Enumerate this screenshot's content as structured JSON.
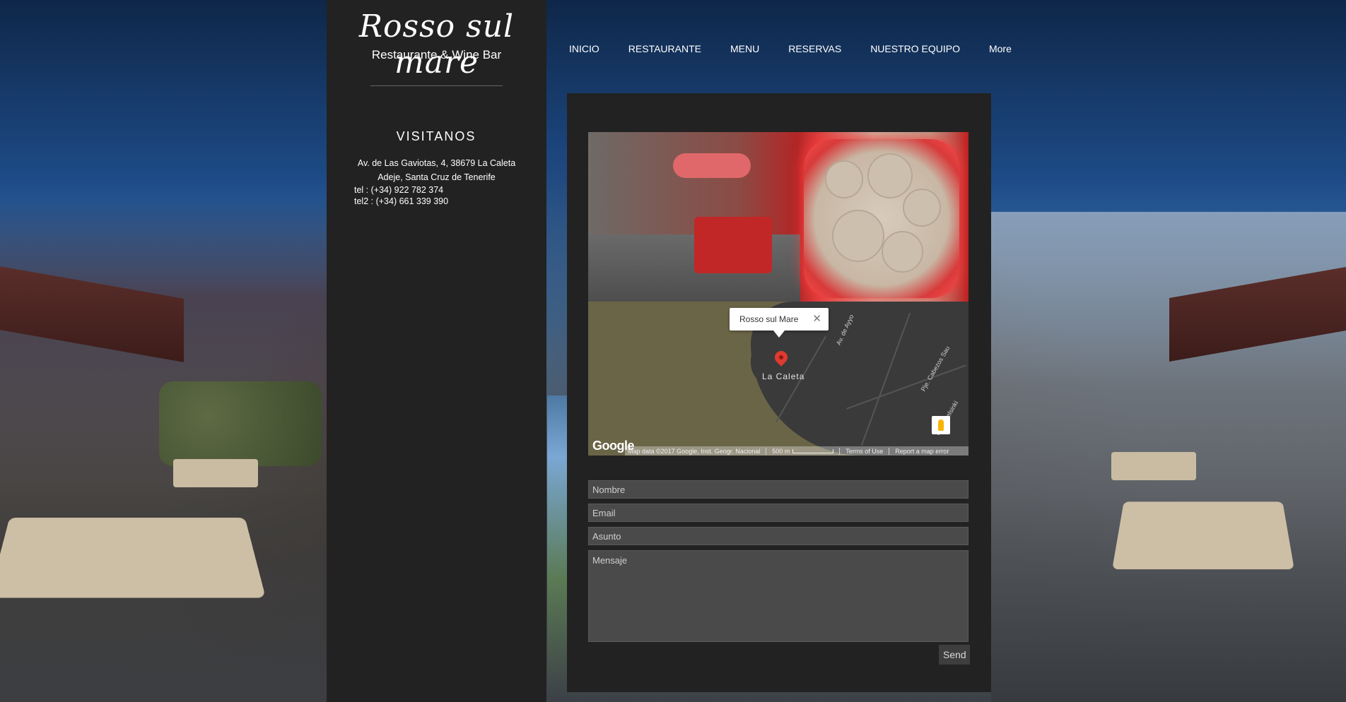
{
  "brand": {
    "name": "Rosso sul mare",
    "tagline": "Restaurante & Wine Bar"
  },
  "nav": {
    "items": [
      {
        "label": "INICIO"
      },
      {
        "label": "RESTAURANTE"
      },
      {
        "label": "MENU"
      },
      {
        "label": "RESERVAS"
      },
      {
        "label": "NUESTRO EQUIPO"
      },
      {
        "label": "More"
      }
    ]
  },
  "sidebar": {
    "title": "VISITANOS",
    "address_line1": "Av. de Las Gaviotas, 4, 38679 La Caleta",
    "address_line2": "Adeje, Santa Cruz de Tenerife",
    "tel1": "tel : (+34) 922 782 374",
    "tel2": "tel2 : (+34) 661 339 390"
  },
  "map": {
    "popup_title": "Rosso sul Mare",
    "close_glyph": "✕",
    "town_label": "La Caleta",
    "road_label_1": "Av. de Ayyo",
    "road_label_2": "Pje. Cabezos Sau",
    "road_label_3": "Calle Helsinki",
    "google_logo": "Google",
    "footer_data": "Map data ©2017 Google, Inst. Geogr. Nacional",
    "footer_scale": "500 m",
    "footer_terms": "Terms of Use",
    "footer_report": "Report a map error"
  },
  "form": {
    "name_placeholder": "Nombre",
    "email_placeholder": "Email",
    "subject_placeholder": "Asunto",
    "message_placeholder": "Mensaje",
    "send_label": "Send"
  },
  "colors": {
    "panel": "#222222",
    "field": "#4a4a4a",
    "pin": "#e03a30"
  }
}
